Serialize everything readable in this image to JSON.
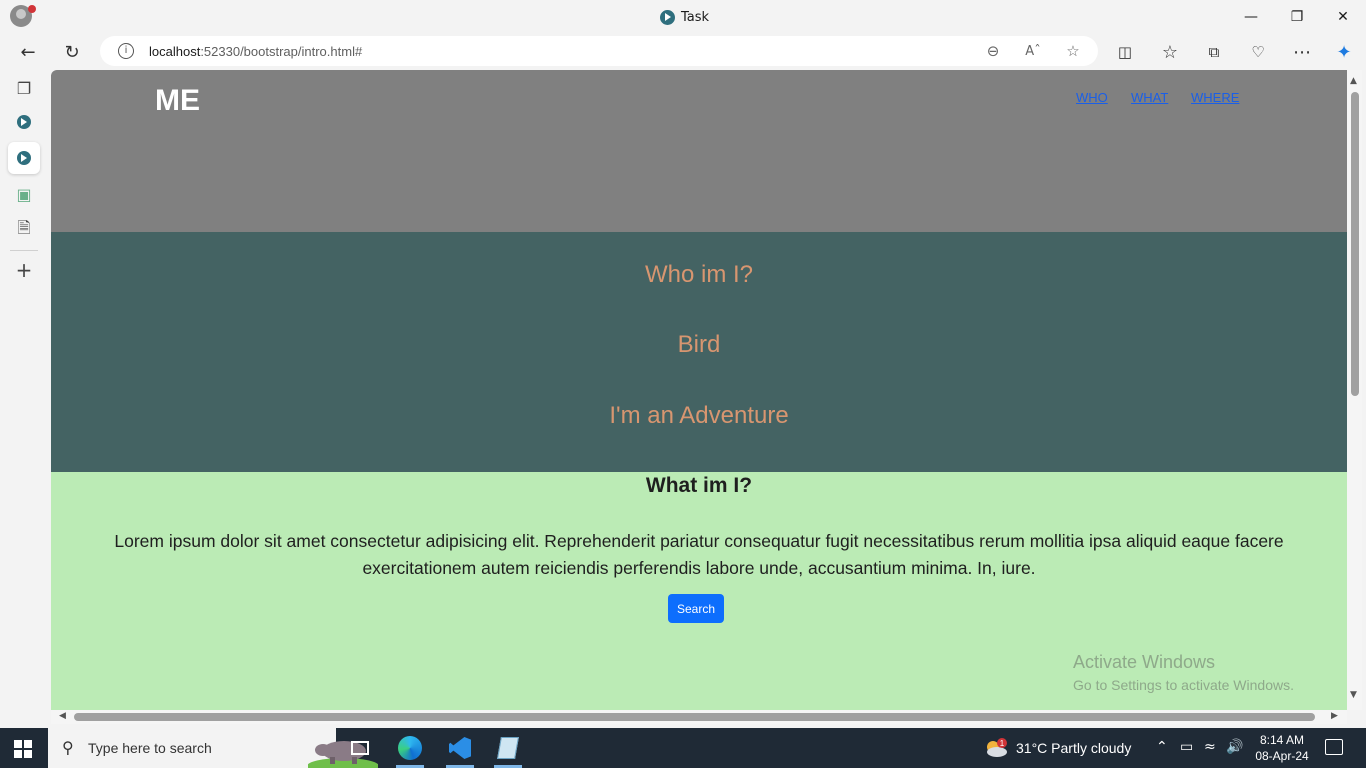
{
  "window": {
    "tab_title": "Task"
  },
  "address_bar": {
    "host": "localhost",
    "rest": ":52330/bootstrap/intro.html#"
  },
  "page": {
    "brand": "ME",
    "nav": [
      "WHO",
      "WHAT",
      "WHERE"
    ],
    "who_section": {
      "lines": [
        "Who im I?",
        "Bird",
        "I'm an Adventure"
      ]
    },
    "what_section": {
      "title": "What im I?",
      "body": "Lorem ipsum dolor sit amet consectetur adipisicing elit. Reprehenderit pariatur consequatur fugit necessitatibus rerum mollitia ipsa aliquid eaque facere exercitationem autem reiciendis perferendis labore unde, accusantium minima. In, iure.",
      "button_label": "Search"
    },
    "watermark": {
      "title": "Activate Windows",
      "subtitle": "Go to Settings to activate Windows."
    }
  },
  "colors": {
    "header_bg": "#808080",
    "who_bg": "#446363",
    "who_text": "#d89670",
    "what_bg": "#bbebb5",
    "button_bg": "#0d6efd",
    "nav_link": "#1a5fe8"
  },
  "taskbar": {
    "search_placeholder": "Type here to search",
    "weather_badge": "1",
    "weather": "31°C  Partly cloudy",
    "time": "8:14 AM",
    "date": "08-Apr-24"
  }
}
